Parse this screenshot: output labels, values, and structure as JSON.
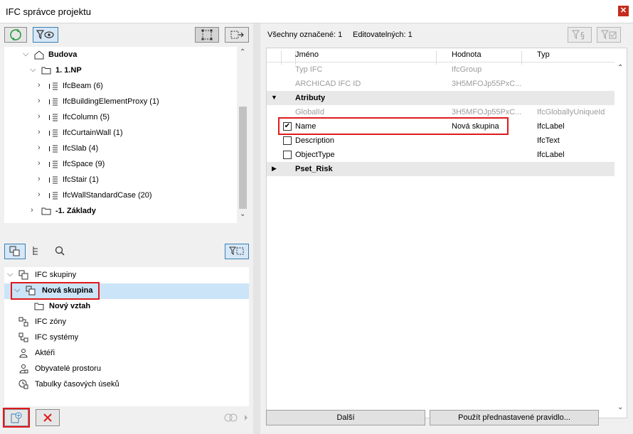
{
  "window": {
    "title": "IFC správce projektu",
    "close_glyph": "✕"
  },
  "top_tree": {
    "items": [
      {
        "label": "Budova",
        "bold": true
      },
      {
        "label": "1. 1.NP",
        "bold": true
      },
      {
        "label": "IfcBeam (6)"
      },
      {
        "label": "IfcBuildingElementProxy (1)"
      },
      {
        "label": "IfcColumn (5)"
      },
      {
        "label": "IfcCurtainWall (1)"
      },
      {
        "label": "IfcSlab (4)"
      },
      {
        "label": "IfcSpace (9)"
      },
      {
        "label": "IfcStair (1)"
      },
      {
        "label": "IfcWallStandardCase (20)"
      },
      {
        "label": "-1. Základy",
        "bold": true
      }
    ]
  },
  "bottom_tree": {
    "items": [
      {
        "label": "IFC skupiny"
      },
      {
        "label": "Nová skupina",
        "bold": true
      },
      {
        "label": "Nový vztah",
        "bold": true
      },
      {
        "label": "IFC zóny"
      },
      {
        "label": "IFC systémy"
      },
      {
        "label": "Aktéři"
      },
      {
        "label": "Obyvatelé prostoru"
      },
      {
        "label": "Tabulky časových úseků"
      }
    ]
  },
  "right": {
    "selected_all": "Všechny označené: 1",
    "editable": "Editovatelných: 1",
    "columns": {
      "name": "Jméno",
      "value": "Hodnota",
      "type": "Typ"
    },
    "rows": [
      {
        "name": "Typ IFC",
        "value": "IfcGroup",
        "type": ""
      },
      {
        "name": "ARCHICAD IFC ID",
        "value": "3H5MFOJp55PxC...",
        "type": ""
      },
      {
        "name": "Atributy",
        "value": "",
        "type": ""
      },
      {
        "name": "GlobalId",
        "value": "3H5MFOJp55PxC...",
        "type": "IfcGloballyUniqueId"
      },
      {
        "name": "Name",
        "value": "Nová skupina",
        "type": "IfcLabel"
      },
      {
        "name": "Description",
        "value": "",
        "type": "IfcText"
      },
      {
        "name": "ObjectType",
        "value": "",
        "type": "IfcLabel"
      },
      {
        "name": "Pset_Risk",
        "value": "",
        "type": ""
      }
    ],
    "btn_next": "Další",
    "btn_apply": "Použít přednastavené pravidlo..."
  },
  "colors": {
    "accent": "#3c7fb1",
    "highlight": "#cce4f7",
    "red": "#e0191c",
    "section": "#e8e8e8"
  }
}
